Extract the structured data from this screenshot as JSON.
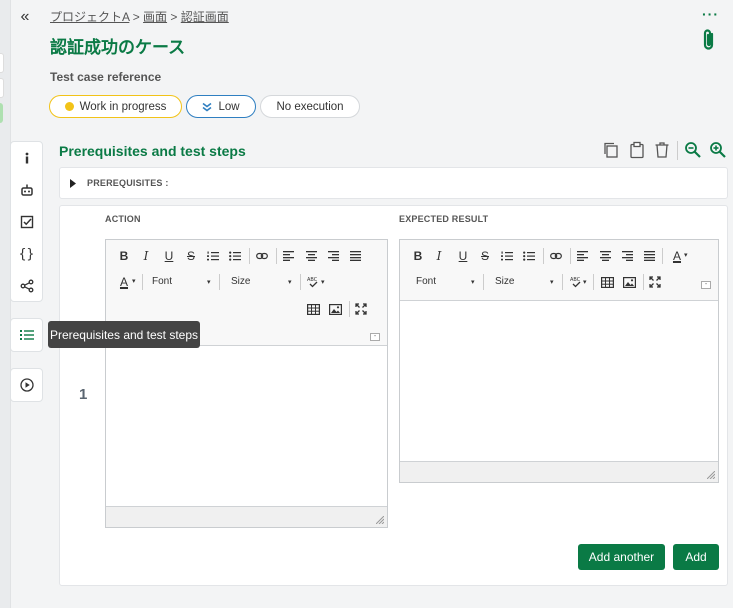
{
  "breadcrumb": {
    "project": "プロジェクトA",
    "sep1": ">",
    "screen": "画面",
    "sep2": ">",
    "auth": "認証画面"
  },
  "title": "認証成功のケース",
  "more_label": "···",
  "reference_label": "Test case reference",
  "pills": {
    "status": "Work in progress",
    "importance": "Low",
    "execution": "No execution"
  },
  "colors": {
    "accent": "#0a7a45",
    "status_dot": "#f2c318",
    "status_border": "#f2c318",
    "importance_border": "#2f7fc1"
  },
  "section_title": "Prerequisites and test steps",
  "prerequisites_label": "PREREQUISITES :",
  "action_header": "ACTION",
  "expected_header": "EXPECTED RESULT",
  "step_number": "1",
  "editor": {
    "font_label": "Font",
    "size_label": "Size",
    "bold": "B",
    "italic": "I",
    "underline": "U",
    "strike": "S",
    "text_color": "A"
  },
  "buttons": {
    "add_another": "Add another",
    "add": "Add"
  },
  "tooltip": "Prerequisites and test steps",
  "icons": [
    "collapse-left-icon",
    "info-icon",
    "robot-icon",
    "checkbox-icon",
    "braces-icon",
    "share-nodes-icon",
    "list-icon",
    "play-circle-icon",
    "paperclip-icon",
    "copy-icon",
    "paste-icon",
    "trash-icon",
    "zoom-out-icon",
    "zoom-in-icon"
  ]
}
